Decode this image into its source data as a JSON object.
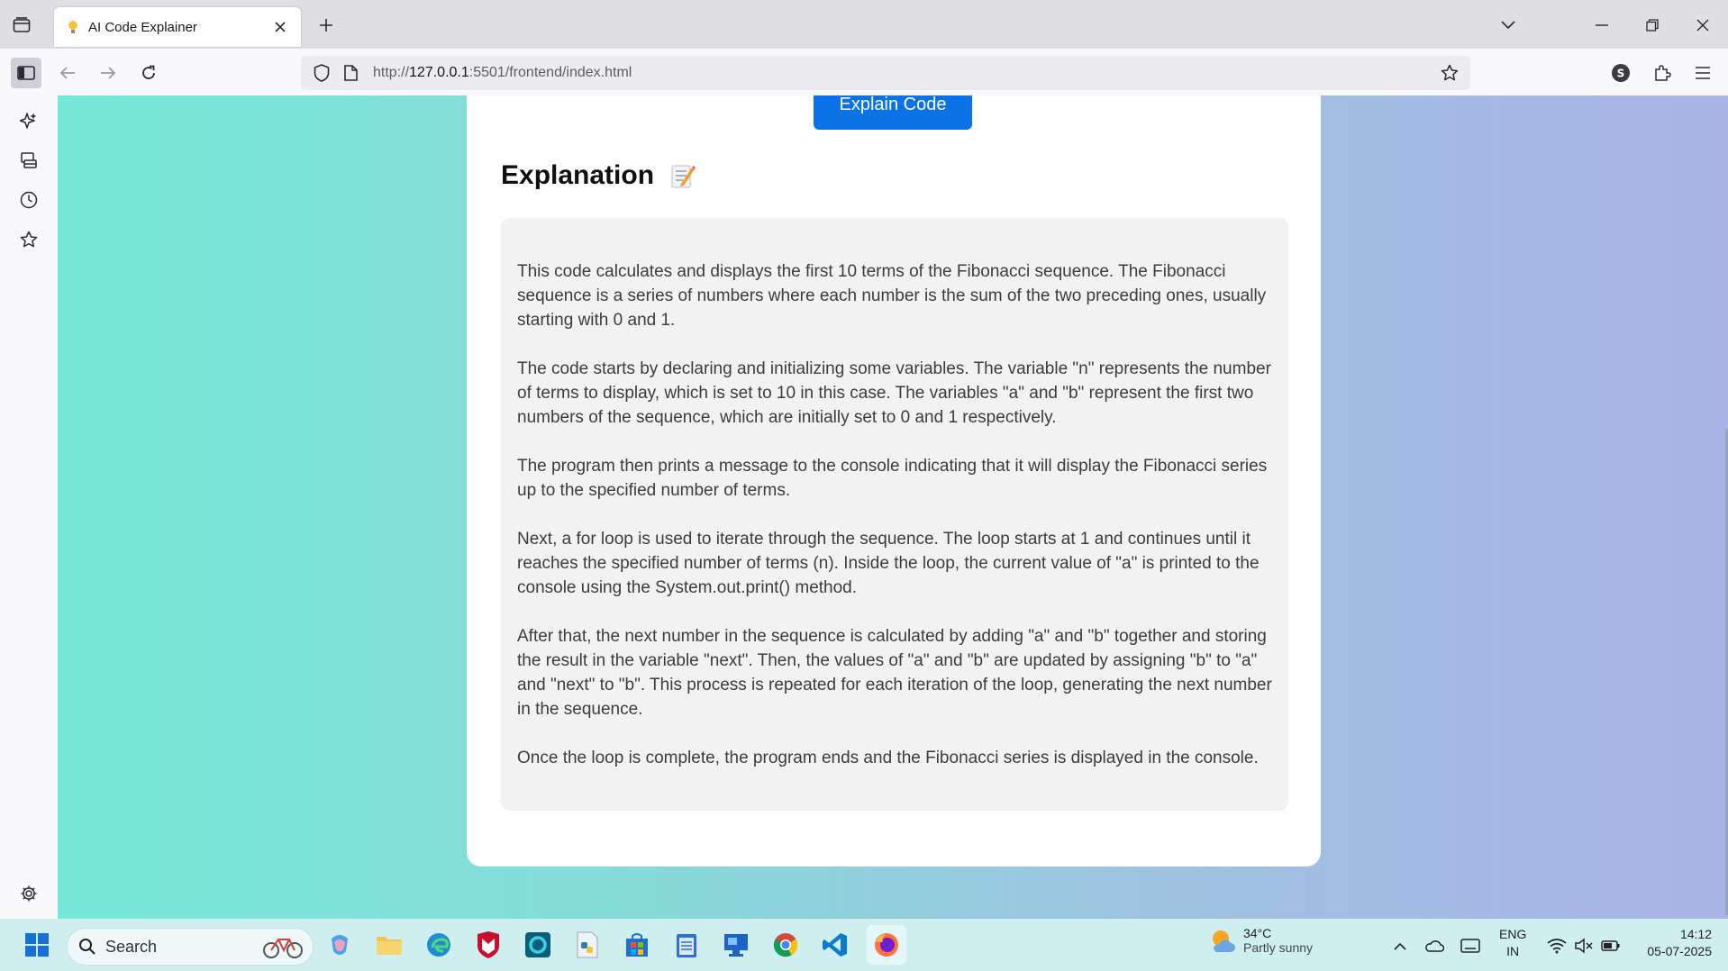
{
  "browser": {
    "tab": {
      "title": "AI Code Explainer",
      "favicon": "lightbulb-icon"
    },
    "url": {
      "host_prefix": "http://",
      "host": "127.0.0.1",
      "rest": ":5501/frontend/index.html"
    }
  },
  "page": {
    "button_label": "Explain Code",
    "heading": "Explanation",
    "paragraphs": [
      "This code calculates and displays the first 10 terms of the Fibonacci sequence. The Fibonacci sequence is a series of numbers where each number is the sum of the two preceding ones, usually starting with 0 and 1.",
      "The code starts by declaring and initializing some variables. The variable \"n\" represents the number of terms to display, which is set to 10 in this case. The variables \"a\" and \"b\" represent the first two numbers of the sequence, which are initially set to 0 and 1 respectively.",
      "The program then prints a message to the console indicating that it will display the Fibonacci series up to the specified number of terms.",
      "Next, a for loop is used to iterate through the sequence. The loop starts at 1 and continues until it reaches the specified number of terms (n). Inside the loop, the current value of \"a\" is printed to the console using the System.out.print() method.",
      "After that, the next number in the sequence is calculated by adding \"a\" and \"b\" together and storing the result in the variable \"next\". Then, the values of \"a\" and \"b\" are updated by assigning \"b\" to \"a\" and \"next\" to \"b\". This process is repeated for each iteration of the loop, generating the next number in the sequence.",
      "Once the loop is complete, the program ends and the Fibonacci series is displayed in the console."
    ]
  },
  "taskbar": {
    "search_placeholder": "Search",
    "weather": {
      "temp": "34°C",
      "desc": "Partly sunny"
    },
    "lang": {
      "line1": "ENG",
      "line2": "IN"
    },
    "clock": {
      "time": "14:12",
      "date": "05-07-2025"
    }
  },
  "colors": {
    "accent": "#0a73e8",
    "card": "#ffffff",
    "explanation_bg": "#f2f2f2"
  }
}
